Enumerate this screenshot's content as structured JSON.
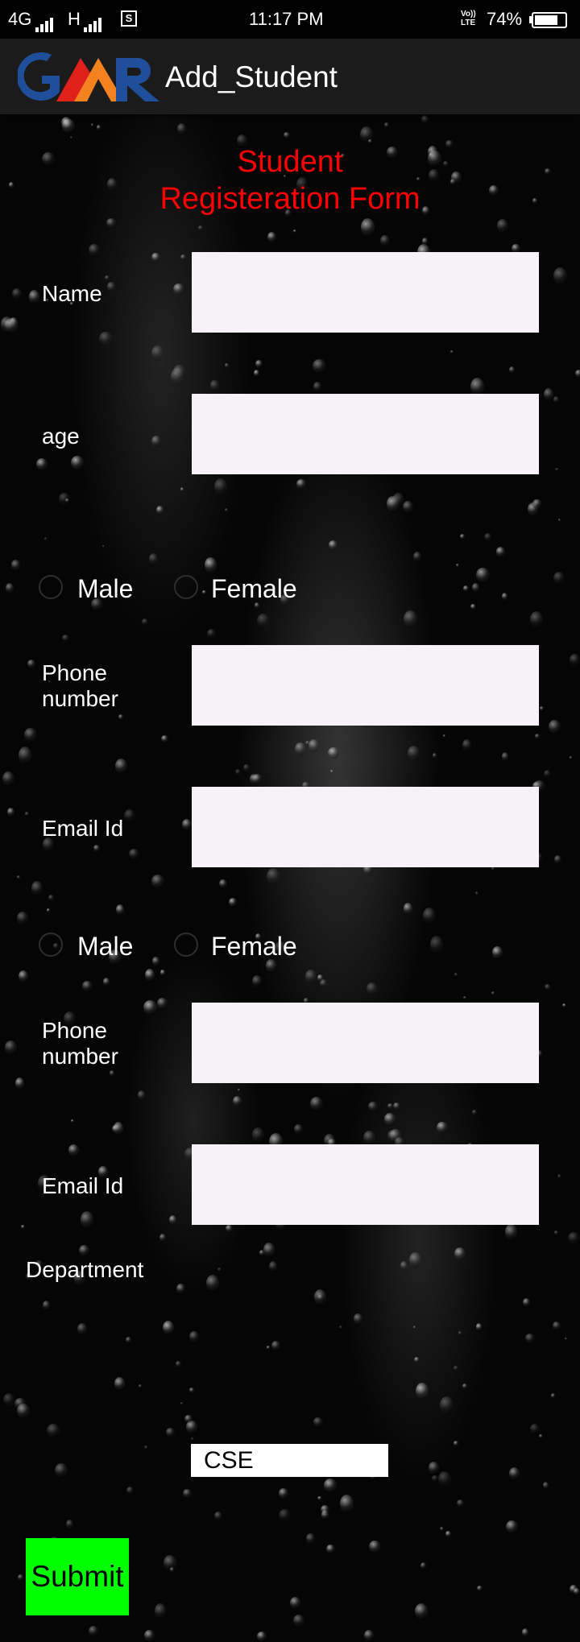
{
  "status_bar": {
    "network_left": "4G",
    "network_h": "H",
    "sim_icon": "S",
    "time": "11:17 PM",
    "volte_line1": "Vo))",
    "volte_line2": "LTE",
    "battery": "74%",
    "battery_level": 0.74
  },
  "app_bar": {
    "logo_text": "GMR",
    "logo_colors": {
      "blue": "#1f4e9a",
      "orange": "#f4831f",
      "red": "#e0201b"
    },
    "title": "Add_Student"
  },
  "form": {
    "title_line1": "Student",
    "title_line2": "Registeration Form",
    "title_color": "#ff0000",
    "name_label": "Name",
    "name_value": "",
    "age_label": "age",
    "age_value": "",
    "gender_1": {
      "male": "Male",
      "female": "Female"
    },
    "phone_1_label_line1": "Phone",
    "phone_1_label_line2": "number",
    "phone_1_value": "",
    "email_1_label": "Email Id",
    "email_1_value": "",
    "gender_2": {
      "male": "Male",
      "female": "Female"
    },
    "phone_2_label_line1": "Phone",
    "phone_2_label_line2": "number",
    "phone_2_value": "",
    "email_2_label": "Email Id",
    "email_2_value": "",
    "department_label": "Department",
    "department_selected": "CSE",
    "submit_label": "Submit",
    "submit_color": "#00ff00"
  }
}
